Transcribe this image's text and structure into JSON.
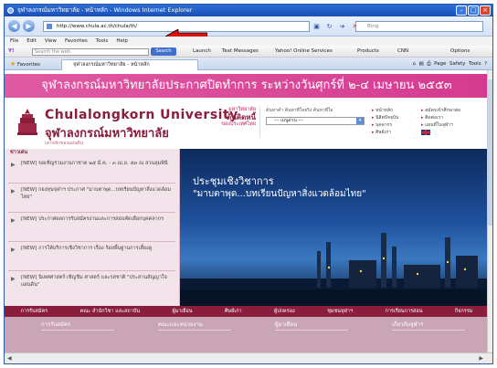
{
  "window": {
    "title": "จุฬาลงกรณ์มหาวิทยาลัย - หน้าหลัก - Windows Internet Explorer"
  },
  "address_bar": {
    "url": "http://www.chula.ac.th/chula/th/",
    "search_placeholder": "Bing"
  },
  "menu": {
    "items": [
      "File",
      "Edit",
      "View",
      "Favorites",
      "Tools",
      "Help"
    ]
  },
  "toolbar": {
    "yahoo_label": "Y!",
    "search_placeholder": "Search the web",
    "search_button": "Search",
    "items": [
      "Launch",
      "Text Messages",
      "Yahoo! Online Services",
      "Products",
      "CNN",
      "Options"
    ]
  },
  "tabbar": {
    "favorites_label": "Favorites",
    "tab_title": "จุฬาลงกรณ์มหาวิทยาลัย - หน้าหลัก",
    "tools": [
      "Page",
      "Safety",
      "Tools"
    ]
  },
  "page": {
    "banner": "จุฬาลงกรณ์มหาวิทยาลัยประกาศปิดทำการ ระหว่างวันศุกร์ที่ ๒-๔ เมษายน ๒๕๕๓",
    "logo_en": "Chulalongkorn University",
    "logo_th": "จุฬาลงกรณ์มหาวิทยาลัย",
    "logo_sub": "เสาหลักของแผ่นดิน",
    "hdr_box": {
      "line1": "มหาวิทยาลัย",
      "line2": "ต้นคิดหนี้",
      "line3": "ของประเทศไทย"
    },
    "select": {
      "label": "ค้นหาคำ ค้นหาที่ใจจริง ค้นหาที่ใจ",
      "value": "--- เมนูด่วน ---"
    },
    "quick_col1": [
      "หน้าหลัก",
      "นิสิตปัจจุบัน",
      "บุคลากร",
      "ศิษย์เก่า"
    ],
    "quick_col2": [
      "สมัครเข้าศึกษาต่อ",
      "ติดต่อเรา",
      "แผนที่ในจุฬาฯ"
    ],
    "sidebar": {
      "title": "ข่าวเด่น",
      "items": [
        {
          "text": "[NEW] ขอเชิญร่วมงานกาชาด ๒๕ มี.ค. - ๓ เม.ย. ๕๓ ณ สวนลุมพินี"
        },
        {
          "text": "[NEW] กองทุนจุฬาฯ ประกาศ \"มาบตาพุด...บทเรียนปัญหาสิ่งแวดล้อมไทย\""
        },
        {
          "text": "[NEW] ประกาศผลการรับสมัครงานและการสอบคัดเลือกบุคคลากร"
        },
        {
          "text": "[NEW] การให้บริการเชิงวิชาการ เรื่อง ร้อยพื้นฐานการเลี้ยงดู"
        },
        {
          "text": "[NEW] นิเทศศาสตร์ เชิญชิม ศาสตร์ และรสชาติ \"ประสานสัญญาใจแผ่นดิน\""
        }
      ]
    },
    "hero": {
      "line1": "ประชุมเชิงวิชาการ",
      "line2": "\"มาบตาพุด...บทเรียนปัญหาสิ่งแวดล้อมไทย\""
    },
    "navbar": [
      "การรับสมัคร",
      "คณะ สำนักวิชา และสถาบัน",
      "ผู้มาเยือน",
      "ศิษย์เก่า",
      "ผู้ปกครอง",
      "ชุมชนจุฬาฯ",
      "การเรียนการสอน",
      "กิจกรรม"
    ],
    "subnav": [
      "การรับสมัคร",
      "คณะและหน่วยงาน",
      "ผู้มาเยือน",
      "เกี่ยวกับจุฬาฯ"
    ]
  },
  "colors": {
    "banner": "#d53a8f",
    "brand": "#8a1c3c",
    "ie_blue": "#1a4fb5",
    "annotation_arrow": "#e01010"
  }
}
